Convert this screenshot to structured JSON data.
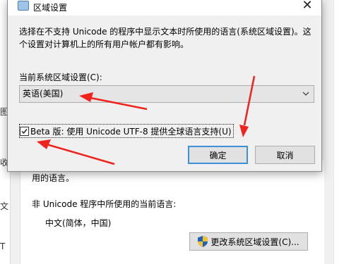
{
  "background": {
    "left_chars": [
      "图",
      "收",
      "文",
      "T"
    ],
    "partial_text": "用的语言。",
    "non_unicode_heading": "非 Unicode 程序中所使用的当前语言:",
    "current_language": "中文(简体，中国)",
    "change_locale_button": "更改系统区域设置(C)..."
  },
  "dialog": {
    "title": "区域设置",
    "close_glyph": "✕",
    "description": "选择在不支持 Unicode 的程序中显示文本时所使用的语言(系统区域设置)。这个设置对计算机上的所有用户帐户都有影响。",
    "locale_label": "当前系统区域设置(C):",
    "locale_value": "英语(美国)",
    "beta_label": "Beta 版: 使用 Unicode UTF-8 提供全球语言支持(U)",
    "beta_checked": true,
    "ok_label": "确定",
    "cancel_label": "取消"
  },
  "colors": {
    "annotation_arrow": "#f0231c",
    "default_button_border": "#3c8fd9"
  }
}
